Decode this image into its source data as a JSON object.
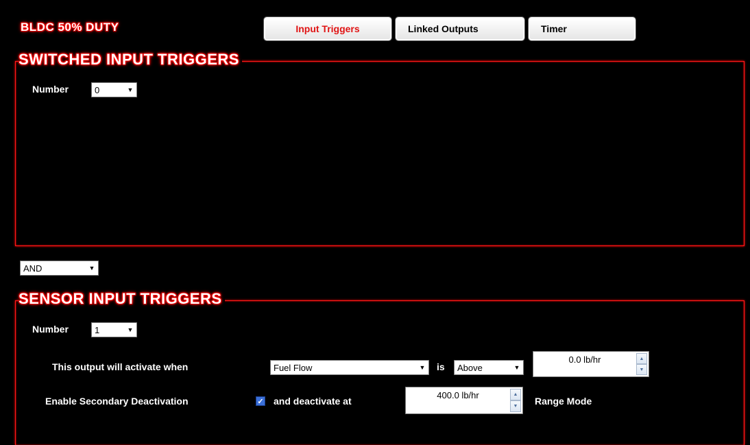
{
  "page": {
    "title": "BLDC 50% DUTY"
  },
  "tabs": [
    {
      "label": "Input Triggers",
      "active": true
    },
    {
      "label": "Linked Outputs",
      "active": false
    },
    {
      "label": "Timer",
      "active": false
    }
  ],
  "switched": {
    "title": "SWITCHED INPUT TRIGGERS",
    "number_label": "Number",
    "number_value": "0"
  },
  "logic": {
    "value": "AND"
  },
  "sensor": {
    "title": "SENSOR INPUT TRIGGERS",
    "number_label": "Number",
    "number_value": "1",
    "activate_label": "This output will activate when",
    "sensor_value": "Fuel Flow",
    "is_label": "is",
    "comparison_value": "Above",
    "threshold_value": "0.0 lb/hr",
    "secondary_label": "Enable Secondary Deactivation",
    "secondary_checked": true,
    "deactivate_label": "and deactivate at",
    "deactivate_value": "400.0 lb/hr",
    "range_mode_label": "Range Mode"
  },
  "colors": {
    "accent": "#ff1a1a",
    "active_tab_text": "#e01414",
    "background": "#000000"
  },
  "icons": {
    "dropdown": "chevron-down-icon",
    "spin_up": "arrow-up-icon",
    "spin_down": "arrow-down-icon",
    "check": "check-icon"
  }
}
